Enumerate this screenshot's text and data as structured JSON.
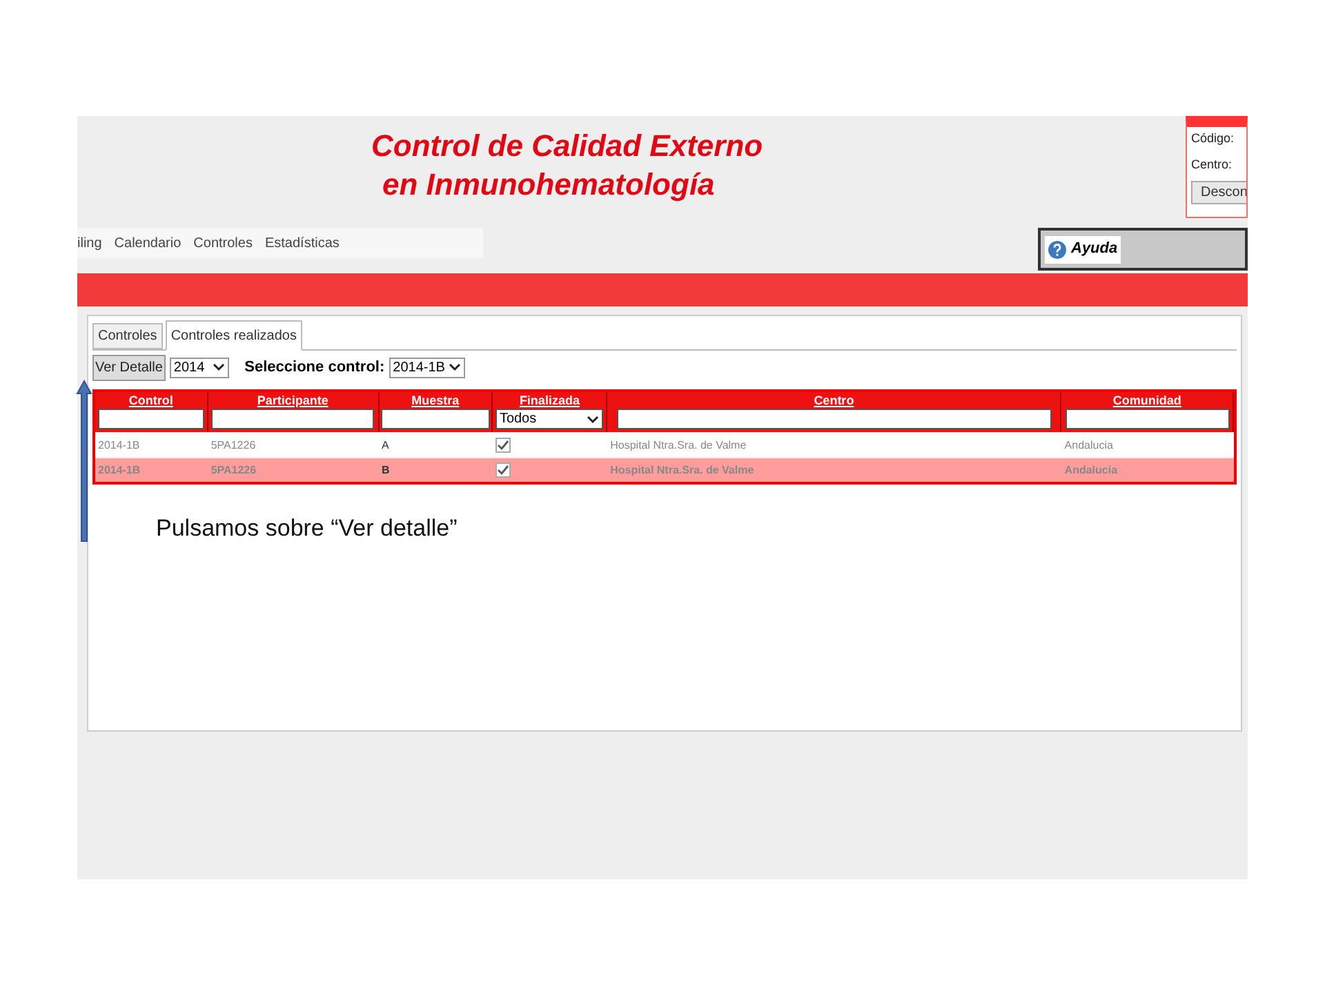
{
  "header": {
    "title_lines": [
      "Control de Calidad Externo",
      "en Inmunohematología"
    ],
    "nav": [
      "iling",
      "Calendario",
      "Controles",
      "Estadísticas"
    ],
    "login": {
      "fields": [
        "Código:",
        "Centro:"
      ],
      "button": "Descon"
    },
    "help": "Ayuda"
  },
  "tabs": [
    {
      "label": "Controles",
      "selected": false
    },
    {
      "label": "Controles realizados",
      "selected": true
    }
  ],
  "toolbar": {
    "button": "Ver Detalle",
    "year": "2014",
    "select_label": "Seleccione control:",
    "control": "2014-1B"
  },
  "table": {
    "columns": [
      "Control",
      "Participante",
      "Muestra",
      "Finalizada",
      "Centro",
      "Comunidad"
    ],
    "filters": [
      {
        "kind": "text"
      },
      {
        "kind": "text"
      },
      {
        "kind": "text"
      },
      {
        "kind": "select",
        "value": "Todos"
      },
      {
        "kind": "text"
      },
      {
        "kind": "text"
      }
    ],
    "rows": [
      {
        "selected": false,
        "control": "2014-1B",
        "participante": "5PA1226",
        "muestra": "A",
        "finalizada": true,
        "centro": "Hospital Ntra.Sra. de Valme",
        "comunidad": "Andalucia"
      },
      {
        "selected": true,
        "control": "2014-1B",
        "participante": "5PA1226",
        "muestra": "B",
        "finalizada": true,
        "centro": "Hospital Ntra.Sra. de Valme",
        "comunidad": "Andalucia"
      }
    ]
  },
  "annotation": {
    "text": "Pulsamos sobre “Ver detalle”"
  }
}
